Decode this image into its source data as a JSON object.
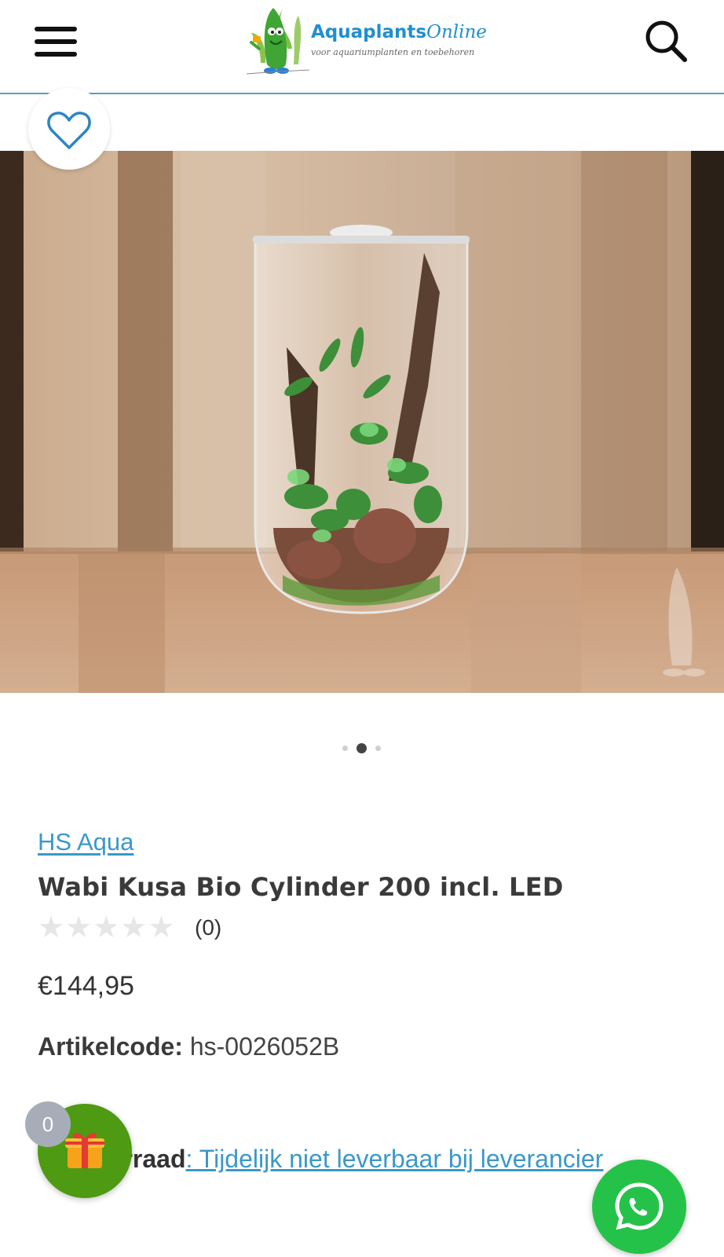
{
  "header": {
    "logo_name": "AquaplantsOnline",
    "logo_brand": "Aquaplants",
    "logo_suffix": "Online",
    "logo_tagline": "voor aquariumplanten en toebehoren",
    "menu_icon": "hamburger-menu-icon",
    "search_icon": "search-icon"
  },
  "wishlist": {
    "icon": "heart-outline-icon"
  },
  "gallery": {
    "slide_count": 3,
    "active_index": 1
  },
  "product": {
    "brand": "HS Aqua",
    "title": "Wabi Kusa Bio Cylinder 200 incl. LED",
    "rating": 0,
    "rating_max": 5,
    "review_count": "(0)",
    "price": "€144,95",
    "sku_label": "Artikelcode:",
    "sku_value": "hs-0026052B",
    "stock_prefix": "Op ",
    "stock_label": "voorraad",
    "stock_colon": ":",
    "stock_status": " Tijdelijk niet leverbaar bij leverancier"
  },
  "floating": {
    "gift_icon": "gift-icon",
    "gift_count": "0",
    "whatsapp_icon": "whatsapp-icon"
  },
  "colors": {
    "accent_blue": "#3a98cc",
    "gift_green": "#4e9a12",
    "whatsapp_green": "#25c24a",
    "badge_gray": "#a7adb8"
  }
}
